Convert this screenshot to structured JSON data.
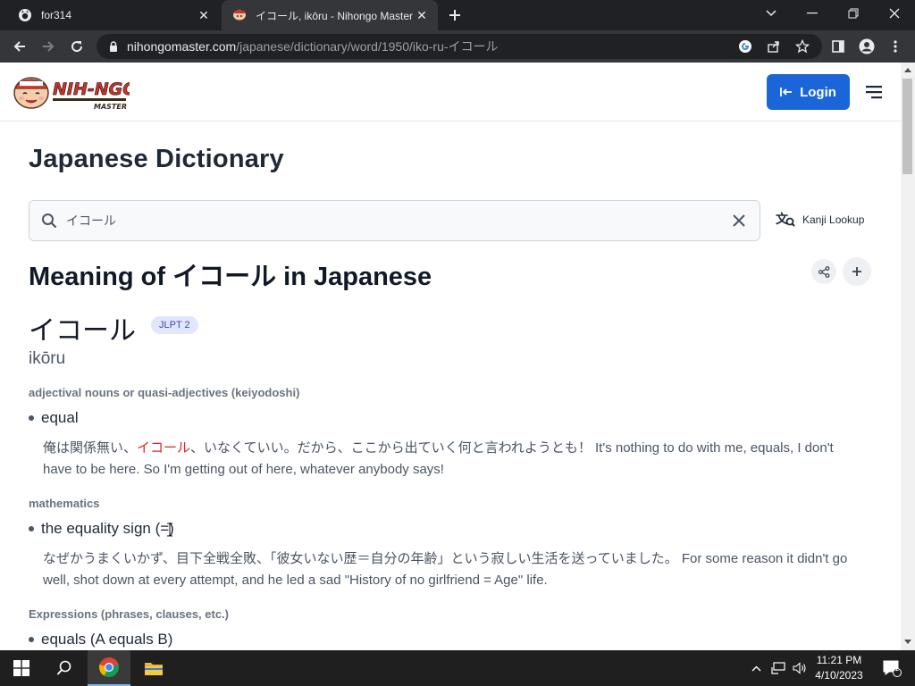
{
  "browser": {
    "tabs": [
      {
        "title": "for314",
        "active": false
      },
      {
        "title": "イコール, ikōru - Nihongo Master",
        "active": true
      }
    ],
    "url_host": "nihongomaster.com",
    "url_path": "/japanese/dictionary/word/1950/iko-ru-イコール",
    "colors": {
      "frame": "#202124",
      "toolbar": "#35363a"
    }
  },
  "header": {
    "logo_alt": "NIHONGO MASTER",
    "login_label": "Login",
    "accent": "#1a66d9"
  },
  "page": {
    "title": "Japanese Dictionary",
    "search_value": "イコール",
    "kanji_lookup_label": "Kanji Lookup",
    "meaning_title": "Meaning of イコール in Japanese",
    "word": "イコール",
    "jlpt": "JLPT 2",
    "romaji": "ikōru"
  },
  "senses": [
    {
      "pos": "adjectival nouns or quasi-adjectives (keiyodoshi)",
      "definition": "equal",
      "example_before": "俺は関係無い、",
      "example_highlight": "イコール",
      "example_after": "、いなくていい。だから、ここから出ていく何と言われようとも！ It's nothing to do with me, equals, I don't have to be here. So I'm getting out of here, whatever anybody says!"
    },
    {
      "pos": "mathematics",
      "definition": "the equality sign (=)",
      "example": "なぜかうまくいかず、目下全戦全敗、「彼女いない歴＝自分の年齢」という寂しい生活を送っていました。 For some reason it didn't go well, shot down at every attempt, and he led a sad \"History of no girlfriend = Age\" life."
    },
    {
      "pos": "Expressions (phrases, clauses, etc.)",
      "definition": "equals (A equals B)"
    }
  ],
  "taskbar": {
    "time": "11:21 PM",
    "date": "4/10/2023",
    "notification_count": "1"
  }
}
